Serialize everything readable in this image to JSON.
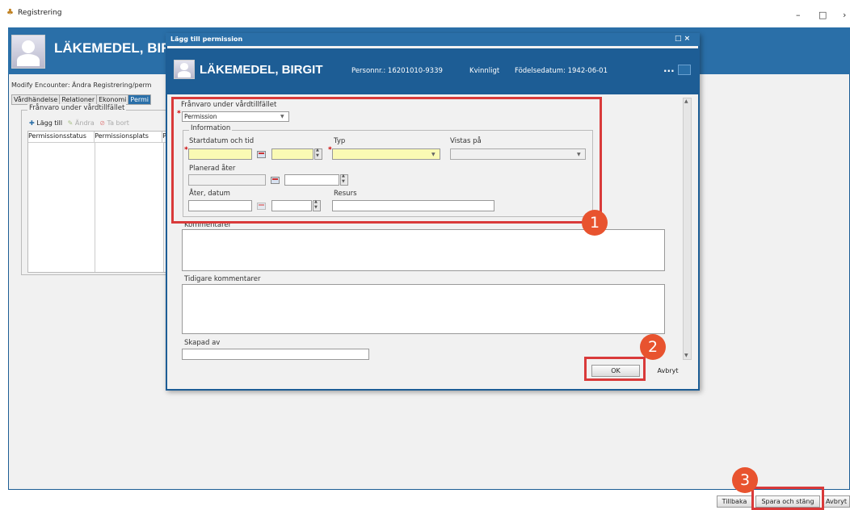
{
  "window": {
    "title": "Registrering"
  },
  "background": {
    "patient_name": "LÄKEMEDEL, BIRG",
    "breadcrumb": "Modify Encounter: Ändra Registrering/perm",
    "tabs": [
      "Vårdhändelse",
      "Relationer",
      "Ekonomi",
      "Permi"
    ],
    "section_legend": "Frånvaro under vårdtillfället",
    "toolbar": {
      "add": "Lägg till",
      "edit": "Ändra",
      "delete": "Ta bort"
    },
    "table_headers": [
      "Permissionsstatus",
      "Permissionsplats",
      "P"
    ],
    "footer_buttons": {
      "back": "Tillbaka",
      "save_close": "Spara och stäng",
      "cancel": "Avbryt"
    }
  },
  "dialog": {
    "title": "Lägg till permission",
    "controls": "□ ×",
    "patient": {
      "name": "LÄKEMEDEL, BIRGIT",
      "personnr": "Personnr.: 16201010-9339",
      "gender": "Kvinnligt",
      "birthdate": "Födelsedatum: 1942-06-01",
      "more": "..."
    },
    "absence_label": "Frånvaro under vårdtillfället",
    "absence_value": "Permission",
    "information_legend": "Information",
    "start_label": "Startdatum och tid",
    "type_label": "Typ",
    "stay_label": "Vistas på",
    "planned_return_label": "Planerad åter",
    "return_date_label": "Åter, datum",
    "resource_label": "Resurs",
    "comments_label": "Kommentarer",
    "previous_comments_label": "Tidigare kommentarer",
    "created_by_label": "Skapad av",
    "ok_label": "OK",
    "cancel_label": "Avbryt"
  },
  "annotations": {
    "badge1": "1",
    "badge2": "2",
    "badge3": "3"
  },
  "colors": {
    "banner": "#2a6fa8",
    "highlight": "#d93a3a",
    "badge": "#e8532f",
    "required_field": "#fafab4"
  }
}
